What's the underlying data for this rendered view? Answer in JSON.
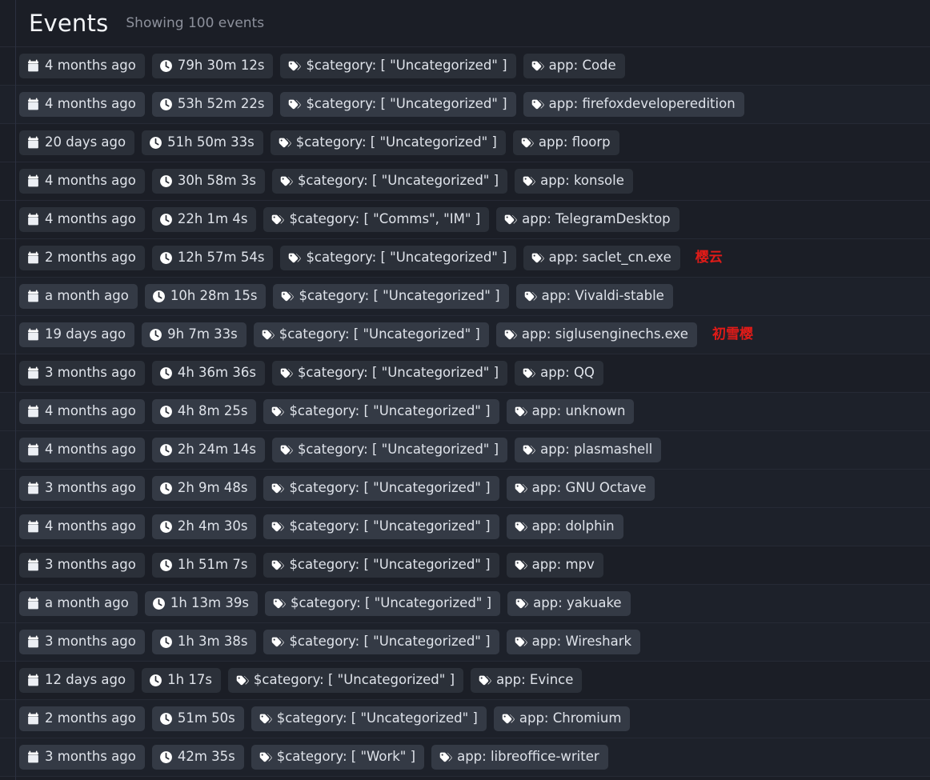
{
  "header": {
    "title": "Events",
    "subtitle": "Showing 100 events"
  },
  "colors": {
    "page_background": "#1b1e26",
    "row_background": "#1b1e26",
    "row_background_alt": "#1d212a",
    "badge_background": "#2b3039",
    "badge_background_light": "#343a45",
    "text": "#dfe3ea",
    "title": "#f3f5f8",
    "subtitle_muted": "#8d919c",
    "note_red": "#e01b18",
    "divider": "#262a35"
  },
  "icons": {
    "date": "calendar-icon",
    "duration": "clock-icon",
    "tag": "tags-icon"
  },
  "rows": [
    {
      "date": "4 months ago",
      "duration": "79h 30m 12s",
      "category": "$category: [ \"Uncategorized\" ]",
      "app": "app: Code",
      "note": "",
      "light": false
    },
    {
      "date": "4 months ago",
      "duration": "53h 52m 22s",
      "category": "$category: [ \"Uncategorized\" ]",
      "app": "app: firefoxdeveloperedition",
      "note": "",
      "light": true
    },
    {
      "date": "20 days ago",
      "duration": "51h 50m 33s",
      "category": "$category: [ \"Uncategorized\" ]",
      "app": "app: floorp",
      "note": "",
      "light": false
    },
    {
      "date": "4 months ago",
      "duration": "30h 58m 3s",
      "category": "$category: [ \"Uncategorized\" ]",
      "app": "app: konsole",
      "note": "",
      "light": false
    },
    {
      "date": "4 months ago",
      "duration": "22h 1m 4s",
      "category": "$category: [ \"Comms\", \"IM\" ]",
      "app": "app: TelegramDesktop",
      "note": "",
      "light": false
    },
    {
      "date": "2 months ago",
      "duration": "12h 57m 54s",
      "category": "$category: [ \"Uncategorized\" ]",
      "app": "app: saclet_cn.exe",
      "note": "樱云",
      "light": false
    },
    {
      "date": "a month ago",
      "duration": "10h 28m 15s",
      "category": "$category: [ \"Uncategorized\" ]",
      "app": "app: Vivaldi-stable",
      "note": "",
      "light": true
    },
    {
      "date": "19 days ago",
      "duration": "9h 7m 33s",
      "category": "$category: [ \"Uncategorized\" ]",
      "app": "app: siglusenginechs.exe",
      "note": "初雪樱",
      "light": true
    },
    {
      "date": "3 months ago",
      "duration": "4h 36m 36s",
      "category": "$category: [ \"Uncategorized\" ]",
      "app": "app: QQ",
      "note": "",
      "light": false
    },
    {
      "date": "4 months ago",
      "duration": "4h 8m 25s",
      "category": "$category: [ \"Uncategorized\" ]",
      "app": "app: unknown",
      "note": "",
      "light": true
    },
    {
      "date": "4 months ago",
      "duration": "2h 24m 14s",
      "category": "$category: [ \"Uncategorized\" ]",
      "app": "app: plasmashell",
      "note": "",
      "light": true
    },
    {
      "date": "3 months ago",
      "duration": "2h 9m 48s",
      "category": "$category: [ \"Uncategorized\" ]",
      "app": "app: GNU Octave",
      "note": "",
      "light": true
    },
    {
      "date": "4 months ago",
      "duration": "2h 4m 30s",
      "category": "$category: [ \"Uncategorized\" ]",
      "app": "app: dolphin",
      "note": "",
      "light": true
    },
    {
      "date": "3 months ago",
      "duration": "1h 51m 7s",
      "category": "$category: [ \"Uncategorized\" ]",
      "app": "app: mpv",
      "note": "",
      "light": false
    },
    {
      "date": "a month ago",
      "duration": "1h 13m 39s",
      "category": "$category: [ \"Uncategorized\" ]",
      "app": "app: yakuake",
      "note": "",
      "light": true
    },
    {
      "date": "3 months ago",
      "duration": "1h 3m 38s",
      "category": "$category: [ \"Uncategorized\" ]",
      "app": "app: Wireshark",
      "note": "",
      "light": true
    },
    {
      "date": "12 days ago",
      "duration": "1h 17s",
      "category": "$category: [ \"Uncategorized\" ]",
      "app": "app: Evince",
      "note": "",
      "light": false
    },
    {
      "date": "2 months ago",
      "duration": "51m 50s",
      "category": "$category: [ \"Uncategorized\" ]",
      "app": "app: Chromium",
      "note": "",
      "light": true
    },
    {
      "date": "3 months ago",
      "duration": "42m 35s",
      "category": "$category: [ \"Work\" ]",
      "app": "app: libreoffice-writer",
      "note": "",
      "light": true
    }
  ]
}
